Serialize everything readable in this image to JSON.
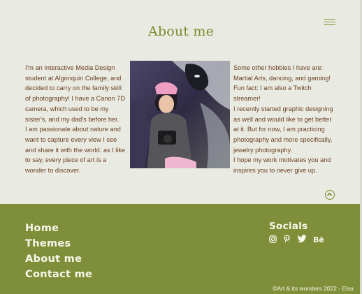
{
  "header": {
    "menu_icon": "hamburger-menu-icon"
  },
  "about": {
    "title": "About me",
    "left_paragraphs": [
      "I'm an Interactive Media Design student at Algonquin College, and decided to carry on the family skill of photography! I have a Canon 7D camera, which used to be my sister's, and my dad's before her.",
      "I am passionate about nature and want to capture every view I see and share it with the world.  as I like to say, every piece of art is a wonder to discover."
    ],
    "right_paragraphs": [
      "Some other hobbies I have are: Martial Arts, dancing, and gaming!",
      "Fun fact: I am also a Twitch streamer!",
      "I recently started graphic designing as well and would like to get better at it. But for now, I am practicing photography and more specifically, jewelry photography.",
      "I hope my work motivates you and inspires you to never give up."
    ],
    "photo_icon": "portrait-photo"
  },
  "back_to_top_icon": "chevron-up-circle-icon",
  "footer": {
    "nav": [
      "Home",
      "Themes",
      "About me",
      "Contact me"
    ],
    "socials_title": "Socials",
    "social_icons": [
      "instagram-icon",
      "pinterest-icon",
      "twitter-icon",
      "behance-icon"
    ],
    "behance_label": "Bē",
    "copyright": "©Art & its wonders 2022 - Elsa"
  },
  "colors": {
    "background": "#e9ebe2",
    "accent": "#7a8b2c",
    "text": "#6b3f22",
    "footer": "#7f8f39",
    "footer_text": "#f7f7ea"
  }
}
